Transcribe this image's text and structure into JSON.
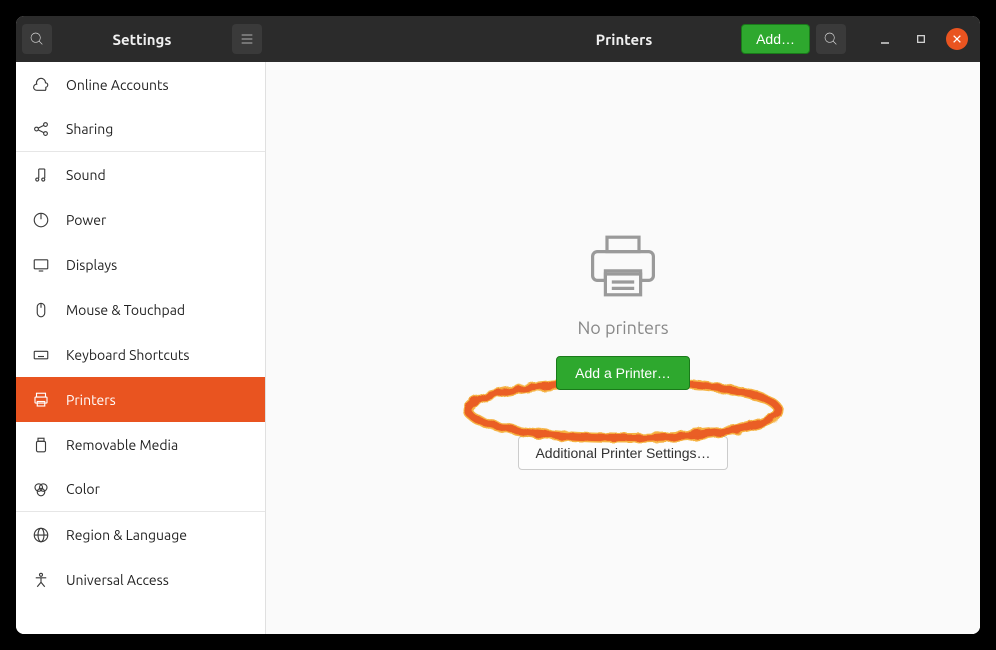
{
  "header": {
    "app_title": "Settings",
    "page_title": "Printers",
    "add_label": "Add…"
  },
  "sidebar": {
    "items": [
      {
        "label": "Online Accounts"
      },
      {
        "label": "Sharing"
      },
      {
        "label": "Sound"
      },
      {
        "label": "Power"
      },
      {
        "label": "Displays"
      },
      {
        "label": "Mouse & Touchpad"
      },
      {
        "label": "Keyboard Shortcuts"
      },
      {
        "label": "Printers"
      },
      {
        "label": "Removable Media"
      },
      {
        "label": "Color"
      },
      {
        "label": "Region & Language"
      },
      {
        "label": "Universal Access"
      }
    ]
  },
  "main": {
    "empty_state": "No printers",
    "add_printer_label": "Add a Printer…",
    "additional_settings_label": "Additional Printer Settings…"
  },
  "annotation": {
    "shape": "ellipse",
    "style": "crayon",
    "color": "#e95420"
  }
}
